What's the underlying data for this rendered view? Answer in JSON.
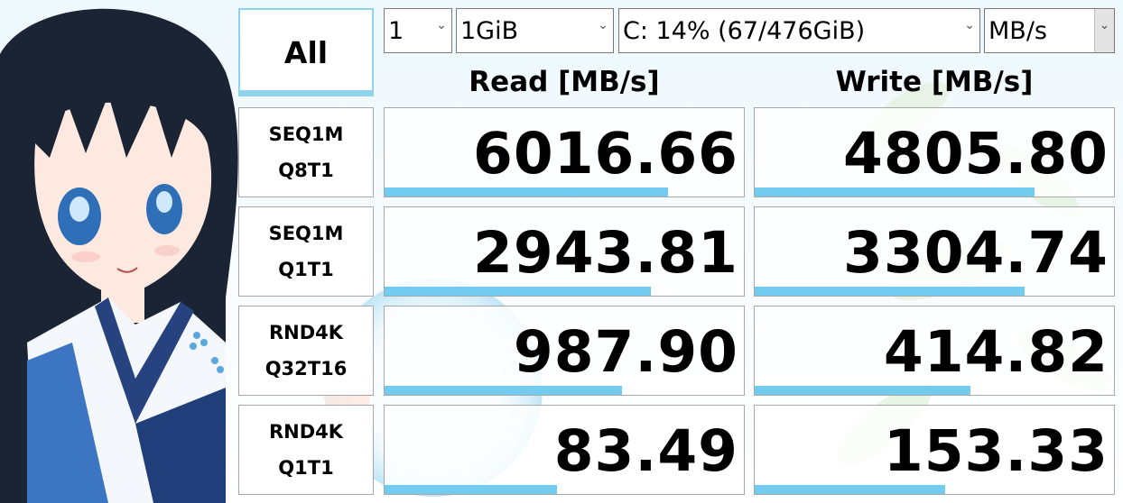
{
  "controls": {
    "all_button": "All",
    "count": "1",
    "size": "1GiB",
    "drive": "C: 14% (67/476GiB)",
    "unit": "MB/s"
  },
  "headers": {
    "read": "Read [MB/s]",
    "write": "Write [MB/s]"
  },
  "rows": [
    {
      "line1": "SEQ1M",
      "line2": "Q8T1",
      "read": "6016.66",
      "write": "4805.80",
      "read_fill": 0.79,
      "write_fill": 0.78
    },
    {
      "line1": "SEQ1M",
      "line2": "Q1T1",
      "read": "2943.81",
      "write": "3304.74",
      "read_fill": 0.74,
      "write_fill": 0.75
    },
    {
      "line1": "RND4K",
      "line2": "Q32T16",
      "read": "987.90",
      "write": "414.82",
      "read_fill": 0.66,
      "write_fill": 0.6
    },
    {
      "line1": "RND4K",
      "line2": "Q1T1",
      "read": "83.49",
      "write": "153.33",
      "read_fill": 0.48,
      "write_fill": 0.53
    }
  ],
  "colors": {
    "bar": "#73cbef",
    "accent_border": "#8ed3ee"
  },
  "icons": {
    "dropdown": "chevron-down-icon"
  }
}
